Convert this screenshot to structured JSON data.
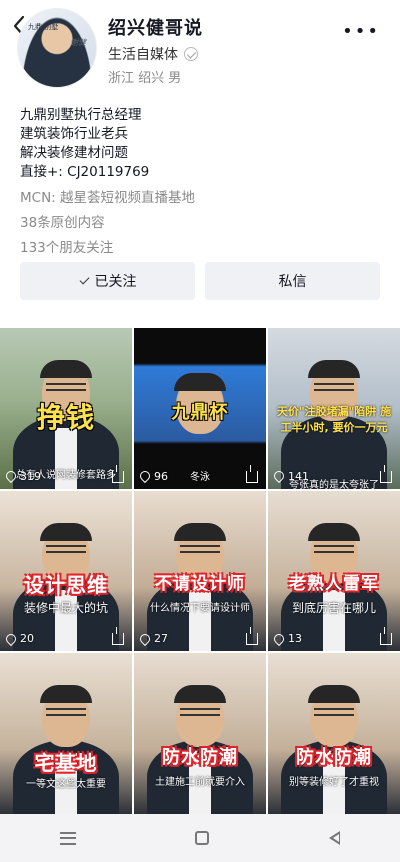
{
  "profile": {
    "name": "绍兴健哥说",
    "verification": "生活自媒体",
    "location": "浙江 绍兴 男",
    "avatar_badge": "九鼎 别墅",
    "avatar_sign": "谢健",
    "bio_lines": [
      "九鼎别墅执行总经理",
      "建筑装饰行业老兵",
      "解决装修建材问题",
      "直接+:   CJ20119769"
    ],
    "mcn": "MCN: 越星荟短视频直播基地",
    "original_count": "38条原创内容",
    "friends_follow": "133个朋友关注"
  },
  "actions": {
    "followed_label": "已关注",
    "message_label": "私信"
  },
  "videos": [
    {
      "title": "挣钱",
      "subtitle": "总有人说网装修套路多",
      "likes": "319"
    },
    {
      "title": "九鼎杯",
      "subtitle": "冬泳",
      "likes": "96"
    },
    {
      "title": "天价\"注胶堵漏\"陷阱 施工半小时, 要价一万元",
      "subtitle": "夸张真的是太夸张了",
      "likes": "141"
    },
    {
      "title": "设计思维",
      "subtitle": "装修中最大的坑",
      "likes": "20"
    },
    {
      "title": "不请设计师",
      "subtitle": "什么情况下要请设计师",
      "likes": "27"
    },
    {
      "title": "老熟人雷军",
      "subtitle": "到底厉害在哪儿",
      "likes": "13"
    },
    {
      "title": "宅基地",
      "subtitle": "一等文这些太重要",
      "likes": ""
    },
    {
      "title": "防水防潮",
      "subtitle": "土建施工前就要介入",
      "likes": ""
    },
    {
      "title": "防水防潮",
      "subtitle": "别等装修好了才重视",
      "likes": ""
    }
  ],
  "colors": {
    "accent": "#e0232a",
    "button_bg": "#eff1f5",
    "caption_yellow": "#ffe14b"
  },
  "icons": [
    "back-icon",
    "more-icon",
    "verify-icon",
    "heart-icon",
    "share-icon",
    "menu-icon",
    "home-icon",
    "back-nav-icon"
  ]
}
